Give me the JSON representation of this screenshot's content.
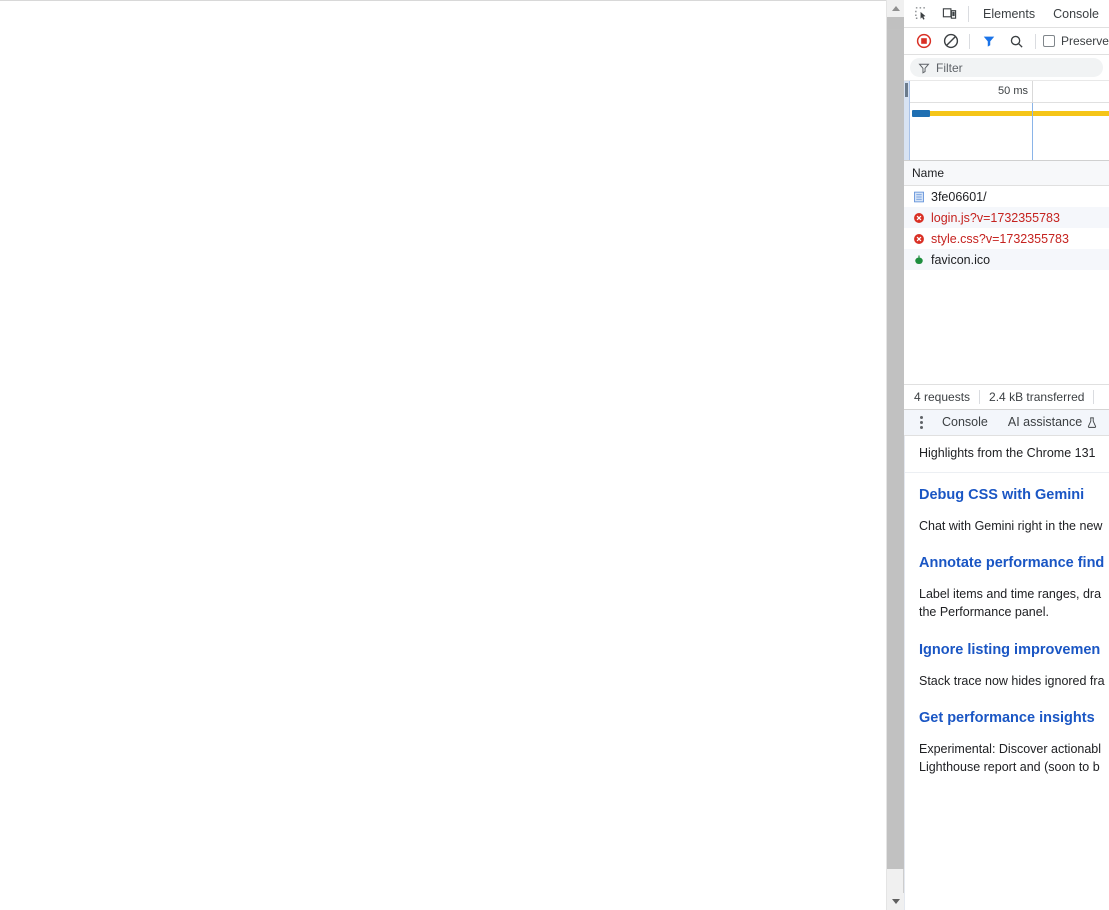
{
  "page": {
    "viewport_background": "#ffffff",
    "blank": true
  },
  "scrollbar": {
    "up_arrow": "scroll-up-arrow",
    "down_arrow": "scroll-down-arrow"
  },
  "devtools": {
    "tabstrip": {
      "inspect_icon": "inspect-element-icon",
      "device_icon": "device-toolbar-icon",
      "tabs": [
        {
          "label": "Elements",
          "active": false
        },
        {
          "label": "Console",
          "active": false
        }
      ]
    },
    "toolbar": {
      "record_icon": "record-stop-icon",
      "clear_icon": "clear-icon",
      "filter_icon": "filter-funnel-icon",
      "search_icon": "search-icon",
      "preserve_log_label": "Preserve",
      "preserve_log_checked": false,
      "accent_record": "#d93025",
      "accent_filter": "#1a73e8"
    },
    "filter": {
      "placeholder": "Filter",
      "value": "",
      "icon": "filter-funnel-icon"
    },
    "overview": {
      "tick_label": "50 ms",
      "band_color": "#f5c518",
      "band_start_color": "#1f6fb2"
    },
    "table": {
      "columns": [
        "Name"
      ],
      "rows": [
        {
          "name": "3fe06601/",
          "icon": "document-icon",
          "status": "ok"
        },
        {
          "name": "login.js?v=1732355783",
          "icon": "error-icon",
          "status": "error"
        },
        {
          "name": "style.css?v=1732355783",
          "icon": "error-icon",
          "status": "error"
        },
        {
          "name": "favicon.ico",
          "icon": "image-icon",
          "status": "ok"
        }
      ]
    },
    "summary": {
      "requests": "4 requests",
      "transferred": "2.4 kB transferred"
    },
    "drawer": {
      "more_icon": "kebab-menu-icon",
      "tabs": [
        {
          "label": "Console",
          "icon": null
        },
        {
          "label": "AI assistance",
          "icon": "flask-icon"
        }
      ]
    },
    "whats_new": {
      "header": "Highlights from the Chrome 131",
      "items": [
        {
          "title": "Debug CSS with Gemini",
          "description": "Chat with Gemini right in the new"
        },
        {
          "title": "Annotate performance find",
          "description": "Label items and time ranges, dra\nthe Performance panel."
        },
        {
          "title": "Ignore listing improvemen",
          "description": "Stack trace now hides ignored fra"
        },
        {
          "title": "Get performance insights",
          "description": "Experimental: Discover actionabl\nLighthouse report and (soon to b"
        }
      ]
    }
  }
}
